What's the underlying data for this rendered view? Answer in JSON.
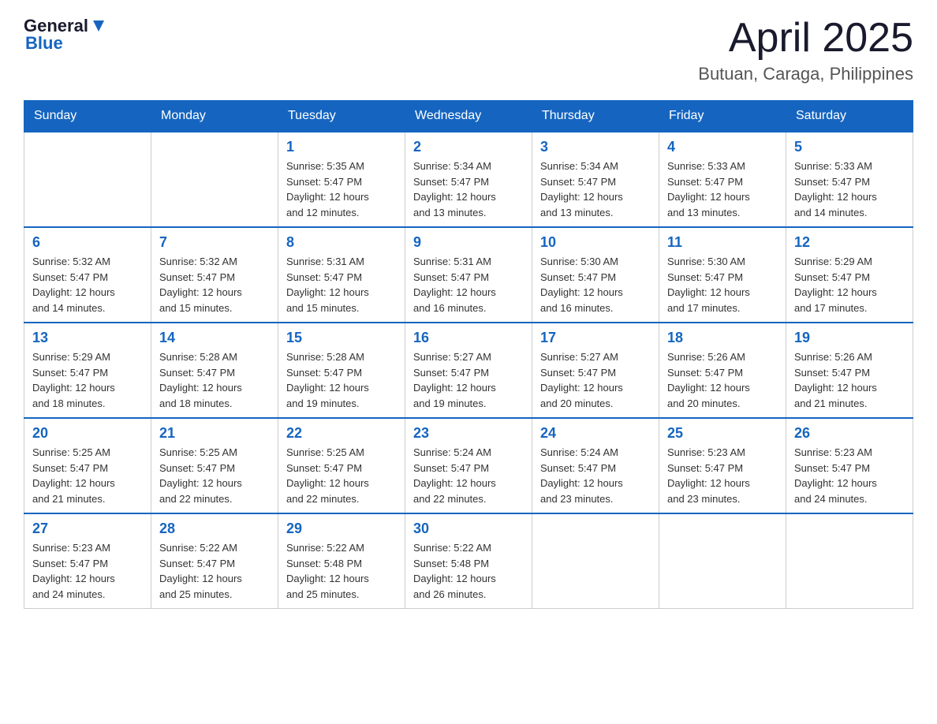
{
  "header": {
    "logo": {
      "general": "General",
      "blue": "Blue"
    },
    "title": "April 2025",
    "location": "Butuan, Caraga, Philippines"
  },
  "calendar": {
    "days_of_week": [
      "Sunday",
      "Monday",
      "Tuesday",
      "Wednesday",
      "Thursday",
      "Friday",
      "Saturday"
    ],
    "weeks": [
      [
        {
          "day": "",
          "info": ""
        },
        {
          "day": "",
          "info": ""
        },
        {
          "day": "1",
          "info": "Sunrise: 5:35 AM\nSunset: 5:47 PM\nDaylight: 12 hours\nand 12 minutes."
        },
        {
          "day": "2",
          "info": "Sunrise: 5:34 AM\nSunset: 5:47 PM\nDaylight: 12 hours\nand 13 minutes."
        },
        {
          "day": "3",
          "info": "Sunrise: 5:34 AM\nSunset: 5:47 PM\nDaylight: 12 hours\nand 13 minutes."
        },
        {
          "day": "4",
          "info": "Sunrise: 5:33 AM\nSunset: 5:47 PM\nDaylight: 12 hours\nand 13 minutes."
        },
        {
          "day": "5",
          "info": "Sunrise: 5:33 AM\nSunset: 5:47 PM\nDaylight: 12 hours\nand 14 minutes."
        }
      ],
      [
        {
          "day": "6",
          "info": "Sunrise: 5:32 AM\nSunset: 5:47 PM\nDaylight: 12 hours\nand 14 minutes."
        },
        {
          "day": "7",
          "info": "Sunrise: 5:32 AM\nSunset: 5:47 PM\nDaylight: 12 hours\nand 15 minutes."
        },
        {
          "day": "8",
          "info": "Sunrise: 5:31 AM\nSunset: 5:47 PM\nDaylight: 12 hours\nand 15 minutes."
        },
        {
          "day": "9",
          "info": "Sunrise: 5:31 AM\nSunset: 5:47 PM\nDaylight: 12 hours\nand 16 minutes."
        },
        {
          "day": "10",
          "info": "Sunrise: 5:30 AM\nSunset: 5:47 PM\nDaylight: 12 hours\nand 16 minutes."
        },
        {
          "day": "11",
          "info": "Sunrise: 5:30 AM\nSunset: 5:47 PM\nDaylight: 12 hours\nand 17 minutes."
        },
        {
          "day": "12",
          "info": "Sunrise: 5:29 AM\nSunset: 5:47 PM\nDaylight: 12 hours\nand 17 minutes."
        }
      ],
      [
        {
          "day": "13",
          "info": "Sunrise: 5:29 AM\nSunset: 5:47 PM\nDaylight: 12 hours\nand 18 minutes."
        },
        {
          "day": "14",
          "info": "Sunrise: 5:28 AM\nSunset: 5:47 PM\nDaylight: 12 hours\nand 18 minutes."
        },
        {
          "day": "15",
          "info": "Sunrise: 5:28 AM\nSunset: 5:47 PM\nDaylight: 12 hours\nand 19 minutes."
        },
        {
          "day": "16",
          "info": "Sunrise: 5:27 AM\nSunset: 5:47 PM\nDaylight: 12 hours\nand 19 minutes."
        },
        {
          "day": "17",
          "info": "Sunrise: 5:27 AM\nSunset: 5:47 PM\nDaylight: 12 hours\nand 20 minutes."
        },
        {
          "day": "18",
          "info": "Sunrise: 5:26 AM\nSunset: 5:47 PM\nDaylight: 12 hours\nand 20 minutes."
        },
        {
          "day": "19",
          "info": "Sunrise: 5:26 AM\nSunset: 5:47 PM\nDaylight: 12 hours\nand 21 minutes."
        }
      ],
      [
        {
          "day": "20",
          "info": "Sunrise: 5:25 AM\nSunset: 5:47 PM\nDaylight: 12 hours\nand 21 minutes."
        },
        {
          "day": "21",
          "info": "Sunrise: 5:25 AM\nSunset: 5:47 PM\nDaylight: 12 hours\nand 22 minutes."
        },
        {
          "day": "22",
          "info": "Sunrise: 5:25 AM\nSunset: 5:47 PM\nDaylight: 12 hours\nand 22 minutes."
        },
        {
          "day": "23",
          "info": "Sunrise: 5:24 AM\nSunset: 5:47 PM\nDaylight: 12 hours\nand 22 minutes."
        },
        {
          "day": "24",
          "info": "Sunrise: 5:24 AM\nSunset: 5:47 PM\nDaylight: 12 hours\nand 23 minutes."
        },
        {
          "day": "25",
          "info": "Sunrise: 5:23 AM\nSunset: 5:47 PM\nDaylight: 12 hours\nand 23 minutes."
        },
        {
          "day": "26",
          "info": "Sunrise: 5:23 AM\nSunset: 5:47 PM\nDaylight: 12 hours\nand 24 minutes."
        }
      ],
      [
        {
          "day": "27",
          "info": "Sunrise: 5:23 AM\nSunset: 5:47 PM\nDaylight: 12 hours\nand 24 minutes."
        },
        {
          "day": "28",
          "info": "Sunrise: 5:22 AM\nSunset: 5:47 PM\nDaylight: 12 hours\nand 25 minutes."
        },
        {
          "day": "29",
          "info": "Sunrise: 5:22 AM\nSunset: 5:48 PM\nDaylight: 12 hours\nand 25 minutes."
        },
        {
          "day": "30",
          "info": "Sunrise: 5:22 AM\nSunset: 5:48 PM\nDaylight: 12 hours\nand 26 minutes."
        },
        {
          "day": "",
          "info": ""
        },
        {
          "day": "",
          "info": ""
        },
        {
          "day": "",
          "info": ""
        }
      ]
    ]
  }
}
